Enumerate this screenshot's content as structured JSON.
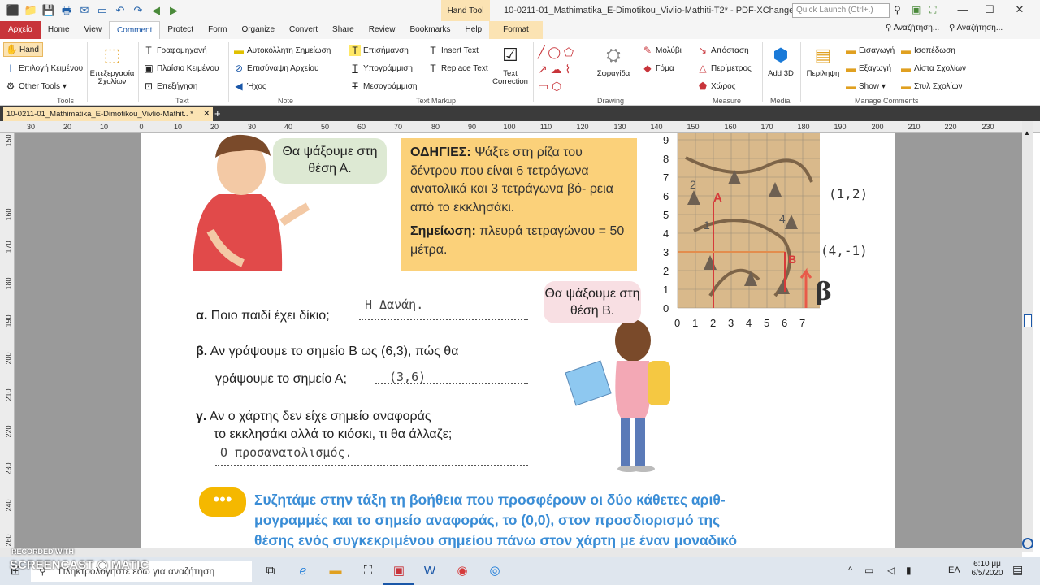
{
  "window": {
    "title": "10-0211-01_Mathimatika_E-Dimotikou_Vivlio-Mathiti-T2* - PDF-XChange Editor",
    "context_tab": "Hand Tool",
    "quick_launch_placeholder": "Quick Launch (Ctrl+.)"
  },
  "tabs": [
    "Αρχείο",
    "Home",
    "View",
    "Comment",
    "Protect",
    "Form",
    "Organize",
    "Convert",
    "Share",
    "Review",
    "Bookmarks",
    "Help",
    "Format"
  ],
  "search_buttons": [
    "Αναζήτηση...",
    "Αναζήτηση..."
  ],
  "ribbon": {
    "tools": {
      "hand": "Hand",
      "select_text": "Επιλογή Κειμένου",
      "other_tools": "Other Tools",
      "label": "Tools"
    },
    "edit_comments": "Επεξεργασία Σχολίων",
    "text": {
      "typewriter": "Γραφομηχανή",
      "textbox": "Πλαίσιο Κειμένου",
      "callout": "Επεξήγηση",
      "label": "Text"
    },
    "note": {
      "sticky": "Αυτοκόλλητη Σημείωση",
      "attach": "Επισύναψη Αρχείου",
      "sound": "Ήχος",
      "label": "Note"
    },
    "markup": {
      "highlight": "Επισήμανση",
      "underline": "Υπογράμμιση",
      "strikeout": "Μεσογράμμιση",
      "insert": "Insert Text",
      "replace": "Replace Text",
      "correction": "Text Correction",
      "label": "Text Markup"
    },
    "drawing": {
      "stamp": "Σφραγίδα",
      "pencil": "Μολύβι",
      "eraser": "Γόμα",
      "label": "Drawing"
    },
    "measure": {
      "distance": "Απόσταση",
      "perimeter": "Περίμετρος",
      "area": "Χώρος",
      "label": "Measure"
    },
    "media": {
      "add3d": "Add 3D",
      "label": "Media"
    },
    "manage": {
      "summary": "Περίληψη",
      "import": "Εισαγωγή",
      "export": "Εξαγωγή",
      "show": "Show",
      "flatten": "Ισοπέδωση",
      "list": "Λίστα Σχολίων",
      "style": "Στυλ Σχολίων",
      "label": "Manage Comments"
    }
  },
  "doc_tab": "10-0211-01_Mathimatika_E-Dimotikou_Vivlio-Mathit.. *",
  "hruler": [
    "30",
    "20",
    "10",
    "0",
    "10",
    "20",
    "30",
    "40",
    "50",
    "60",
    "70",
    "80",
    "90",
    "100",
    "110",
    "120",
    "130",
    "140",
    "150",
    "160",
    "170",
    "180",
    "190",
    "200",
    "210",
    "220",
    "230"
  ],
  "vruler": [
    "150",
    "160",
    "170",
    "180",
    "190",
    "200",
    "210",
    "220",
    "230",
    "240",
    "250",
    "260"
  ],
  "page": {
    "bubble_a": "Θα ψάξουμε στη θέση Α.",
    "bubble_b": "Θα ψάξουμε στη θέση Β.",
    "instructions_label": "ΟΔΗΓΙΕΣ:",
    "instructions": "Ψάξτε στη ρίζα του δέντρου που είναι 6 τετράγωνα ανατολικά και 3 τετράγωνα βό- ρεια από το εκκλησάκι.",
    "note_label": "Σημείωση:",
    "note": "πλευρά τετραγώνου = 50 μέτρα.",
    "qa_letter": "α.",
    "qa_text": "Ποιο παιδί έχει δίκιο;",
    "qa_answer": "Η Δανάη.",
    "qb_letter": "β.",
    "qb_text1": "Αν γράψουμε το σημείο Β ως (6,3), πώς θα",
    "qb_text2": "γράψουμε το σημείο Α;",
    "qb_answer": "(3,6)",
    "qc_letter": "γ.",
    "qc_text1": "Αν ο χάρτης δεν είχε σημείο αναφοράς",
    "qc_text2": "το εκκλησάκι αλλά το κιόσκι, τι θα άλλαζε;",
    "qc_answer": "Ο προσανατολισμός.",
    "discuss_icon": "speech-bubble-icon",
    "discuss1": "Συζητάμε στην τάξη τη βοήθεια που προσφέρουν οι δύο κάθετες αριθ-",
    "discuss2": "μογραμμές και το σημείο αναφοράς, το (0,0), στον προσδιορισμό της",
    "discuss3": "θέσης ενός συγκεκριμένου σημείου πάνω στον χάρτη με έναν μοναδικό",
    "map": {
      "y_ticks": [
        "0",
        "1",
        "2",
        "3",
        "4",
        "5",
        "6",
        "7",
        "8",
        "9"
      ],
      "x_ticks": [
        "0",
        "1",
        "2",
        "3",
        "4",
        "5",
        "6",
        "7"
      ],
      "label_a": "A",
      "label_b": "B",
      "beta": "β",
      "hand1": "(1,2)",
      "hand2": "(4,-1)",
      "n1": "1",
      "n2": "2",
      "n4": "4"
    }
  },
  "watermark": {
    "line1": "RECORDED WITH",
    "line2": "SCREENCAST",
    "line3": "MATIC"
  },
  "taskbar": {
    "search": "Πληκτρολογήστε εδώ για αναζήτηση",
    "lang": "ΕΛ",
    "time": "6:10 μμ",
    "date": "6/5/2020"
  }
}
